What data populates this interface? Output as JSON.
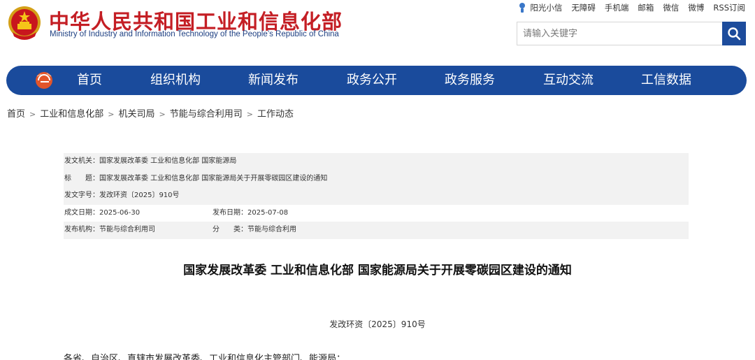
{
  "header": {
    "title": "中华人民共和国工业和信息化部",
    "subtitle": "Ministry of Industry and Information Technology of the People’s Republic of China",
    "links": [
      "阳光小信",
      "无障碍",
      "手机端",
      "邮箱",
      "微信",
      "微博",
      "RSS订阅"
    ],
    "search_placeholder": "请输入关键字"
  },
  "nav": {
    "items": [
      "首页",
      "组织机构",
      "新闻发布",
      "政务公开",
      "政务服务",
      "互动交流",
      "工信数据"
    ]
  },
  "breadcrumb": [
    "首页",
    "工业和信息化部",
    "机关司局",
    "节能与综合利用司",
    "工作动态"
  ],
  "meta": {
    "issuer": "发文机关：国家发展改革委 工业和信息化部 国家能源局",
    "subject": "标　　题：国家发展改革委 工业和信息化部 国家能源局关于开展零碳园区建设的通知",
    "doc_no": "发文字号：发改环资〔2025〕910号",
    "created": "成文日期：2025-06-30",
    "published": "发布日期：2025-07-08",
    "agency": "发布机构：节能与综合利用司",
    "category": "分　　类：节能与综合利用"
  },
  "article": {
    "title": "国家发展改革委 工业和信息化部 国家能源局关于开展零碳园区建设的通知",
    "doc_number": "发改环资〔2025〕910号",
    "first_line": "各省、自治区、直辖市发展改革委、工业和信息化主管部门、能源局："
  },
  "colors": {
    "brand_red": "#c41e24",
    "nav_blue": "#1a4b9c"
  }
}
